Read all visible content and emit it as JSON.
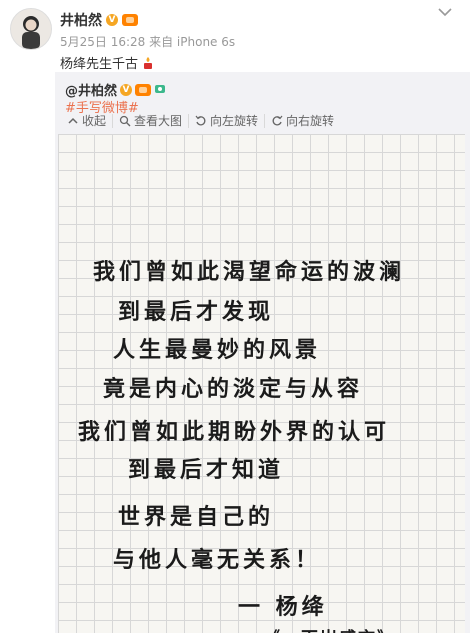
{
  "post": {
    "author_name": "井柏然",
    "meta": "5月25日 16:28 来自 iPhone 6s",
    "text": "杨绛先生千古"
  },
  "repost": {
    "author_name": "@井柏然",
    "topic": "#手写微博#",
    "toolbar": [
      {
        "label": "收起",
        "icon": "collapse-icon"
      },
      {
        "label": "查看大图",
        "icon": "magnifier-icon"
      },
      {
        "label": "向左旋转",
        "icon": "rotate-left-icon"
      },
      {
        "label": "向右旋转",
        "icon": "rotate-right-icon"
      }
    ]
  },
  "handwriting": {
    "lines": [
      "我们曾如此渴望命运的波澜",
      "到最后才发现",
      "人生最曼妙的风景",
      "竟是内心的淡定与从容",
      "我们曾如此期盼外界的认可",
      "到最后才知道",
      "世界是自己的",
      "与他人毫无关系！",
      "一 杨绛",
      "《一百岁感言》"
    ]
  },
  "colors": {
    "link": "#eb7350",
    "verified_badge": "#f5a623",
    "repost_bg": "#f2f2f5"
  }
}
